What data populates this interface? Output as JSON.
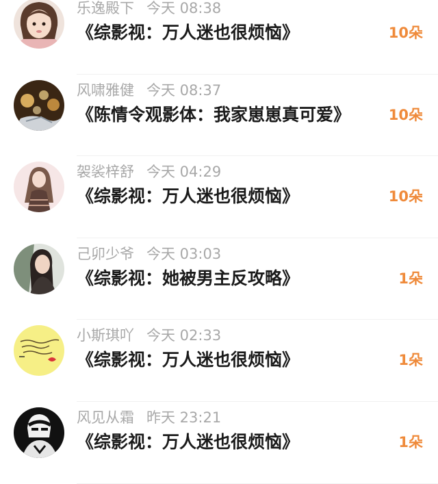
{
  "comments": [
    {
      "user": "乐逸殿下",
      "time": "今天 08:38",
      "title": "《综影视：万人迷也很烦恼》",
      "gift": "10朵",
      "avatar": "avatar-girl-pink"
    },
    {
      "user": "风啸雅健",
      "time": "今天 08:37",
      "title": "《陈情令观影体：我家崽崽真可爱》",
      "gift": "10朵",
      "avatar": "avatar-bokeh-lights"
    },
    {
      "user": "袈裟梓舒",
      "time": "今天 04:29",
      "title": "《综影视：万人迷也很烦恼》",
      "gift": "10朵",
      "avatar": "avatar-drawn-girl"
    },
    {
      "user": "己卯少爷",
      "time": "今天 03:03",
      "title": "《综影视：她被男主反攻略》",
      "gift": "1朵",
      "avatar": "avatar-girl-portrait"
    },
    {
      "user": "小斯琪吖",
      "time": "今天 02:33",
      "title": "《综影视：万人迷也很烦恼》",
      "gift": "1朵",
      "avatar": "avatar-yellow-note"
    },
    {
      "user": "风见从霜",
      "time": "昨天 23:21",
      "title": "《综影视：万人迷也很烦恼》",
      "gift": "1朵",
      "avatar": "avatar-dark-figure"
    }
  ],
  "colors": {
    "username": "#a8a8a8",
    "title": "#1a1a1a",
    "gift": "#ef8a3a",
    "divider": "#f1f1f1"
  }
}
